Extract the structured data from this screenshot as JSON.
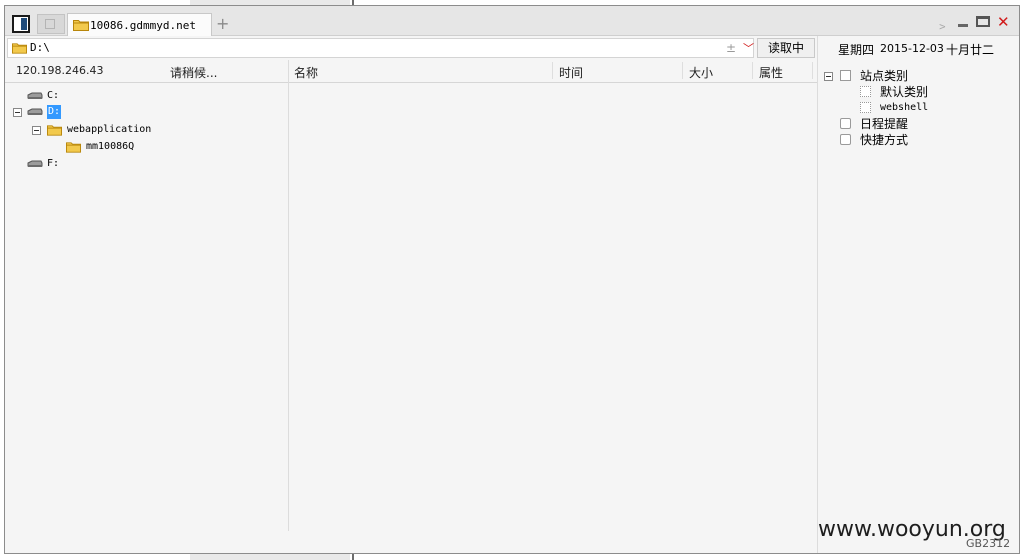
{
  "tabs": {
    "active_label": "10086.gdmmyd.net",
    "new_tab_glyph": "+"
  },
  "window_controls": {
    "chevron_glyph": "﹥",
    "close_glyph": "✕"
  },
  "address": {
    "path": "D:\\",
    "up_glyph": "±",
    "dropdown_glyph": "﹀",
    "read_button": "读取中"
  },
  "left_panel": {
    "ip": "120.198.246.43",
    "status": "请稍候...",
    "tree": [
      {
        "label": "C:",
        "type": "drive",
        "level": 0,
        "expanded": false,
        "selected": false
      },
      {
        "label": "D:",
        "type": "drive",
        "level": 0,
        "expanded": true,
        "selected": true
      },
      {
        "label": "webapplication",
        "type": "folder",
        "level": 1,
        "expanded": true,
        "selected": false
      },
      {
        "label": "mm10086Q",
        "type": "folder",
        "level": 2,
        "expanded": false,
        "selected": false
      },
      {
        "label": "F:",
        "type": "drive",
        "level": 0,
        "expanded": false,
        "selected": false
      }
    ]
  },
  "file_list": {
    "columns": [
      "名称",
      "时间",
      "大小",
      "属性"
    ]
  },
  "right_panel": {
    "weekday": "星期四",
    "date": "2015-12-03",
    "lunar": "十月廿二",
    "tree": [
      {
        "label": "站点类别",
        "level": 0,
        "icon": "category-icon"
      },
      {
        "label": "默认类别",
        "level": 1,
        "icon": "list-icon"
      },
      {
        "label": "webshell",
        "level": 1,
        "icon": "list-icon"
      },
      {
        "label": "日程提醒",
        "level": 0,
        "icon": "schedule-icon"
      },
      {
        "label": "快捷方式",
        "level": 0,
        "icon": "shortcut-icon"
      }
    ]
  },
  "footer": {
    "watermark": "www.wooyun.org",
    "encoding": "GB2312"
  },
  "colors": {
    "selection": "#3399ff",
    "close": "#d11a1a",
    "folder": "#f2c94c",
    "window_bg": "#f5f5f5"
  }
}
